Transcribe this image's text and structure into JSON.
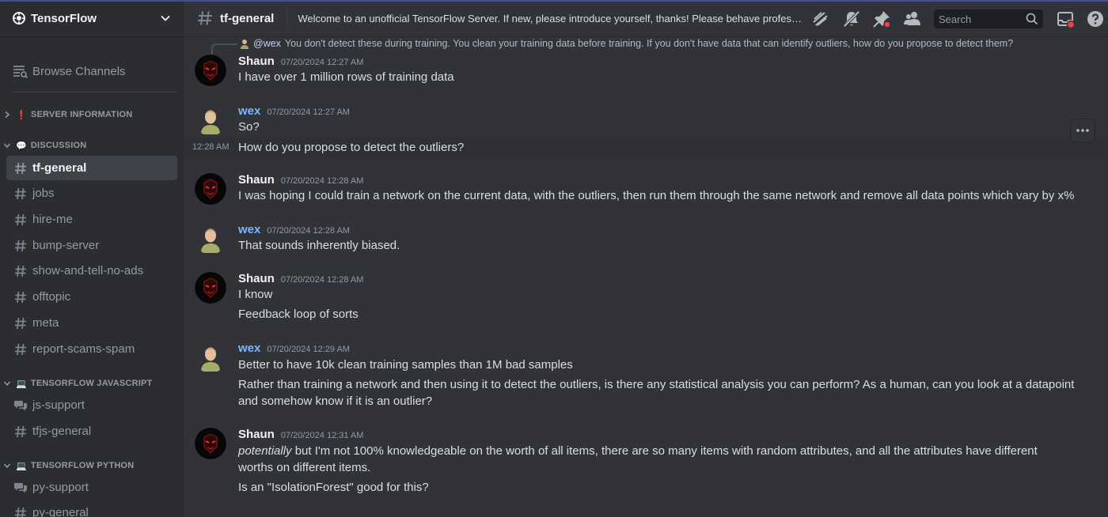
{
  "server": {
    "name": "TensorFlow"
  },
  "sidebar": {
    "browse_label": "Browse Channels",
    "categories": [
      {
        "label": "SERVER INFORMATION",
        "emoji": "❗"
      },
      {
        "label": "DISCUSSION",
        "emoji": "💬"
      },
      {
        "label": "TENSORFLOW JAVASCRIPT",
        "emoji": "💻"
      },
      {
        "label": "TENSORFLOW PYTHON",
        "emoji": "💻"
      }
    ],
    "channels": [
      {
        "label": "tf-general",
        "icon": "hash-icon",
        "active": true
      },
      {
        "label": "jobs",
        "icon": "hash-icon"
      },
      {
        "label": "hire-me",
        "icon": "hash-icon"
      },
      {
        "label": "bump-server",
        "icon": "hash-icon"
      },
      {
        "label": "show-and-tell-no-ads",
        "icon": "hash-icon"
      },
      {
        "label": "offtopic",
        "icon": "hash-icon"
      },
      {
        "label": "meta",
        "icon": "hash-icon"
      },
      {
        "label": "report-scams-spam",
        "icon": "hash-icon"
      },
      {
        "label": "js-support",
        "icon": "forum-icon"
      },
      {
        "label": "tfjs-general",
        "icon": "hash-icon"
      },
      {
        "label": "py-support",
        "icon": "forum-icon"
      },
      {
        "label": "py-general",
        "icon": "hash-icon"
      }
    ]
  },
  "header": {
    "channel_name": "tf-general",
    "topic": "Welcome to an unofficial TensorFlow Server. If new, please introduce yourself, thanks! Please behave professi...",
    "search_placeholder": "Search",
    "icons": [
      "threads-icon",
      "notification-muted-icon",
      "pinned-messages-icon",
      "member-list-icon",
      "inbox-icon",
      "help-icon"
    ]
  },
  "colors": {
    "accent": "#5865f2",
    "wex_name": "#7eb6ff",
    "muted_icon_red": "#f23f43"
  },
  "messages": {
    "reply": {
      "author": "@wex",
      "text": "You don't detect these during training. You clean your training data before training. If you don't have data that can identify outliers, how do you propose to detect them?"
    },
    "m1": {
      "author": "Shaun",
      "timestamp": "07/20/2024 12:27 AM",
      "lines": [
        "I have over 1 million rows of training data"
      ]
    },
    "m2": {
      "author": "wex",
      "timestamp": "07/20/2024 12:27 AM",
      "lines": [
        "So?"
      ]
    },
    "m2b": {
      "timestamp": "12:28 AM",
      "lines": [
        "How do you propose to detect the outliers?"
      ]
    },
    "m3": {
      "author": "Shaun",
      "timestamp": "07/20/2024 12:28 AM",
      "lines": [
        "I was hoping I could train a network on the current data, with the outliers, then run them through the same network and remove all data points which vary by x%"
      ]
    },
    "m4": {
      "author": "wex",
      "timestamp": "07/20/2024 12:28 AM",
      "lines": [
        "That sounds inherently biased."
      ]
    },
    "m5": {
      "author": "Shaun",
      "timestamp": "07/20/2024 12:28 AM",
      "lines": [
        "I know",
        "Feedback loop of sorts"
      ]
    },
    "m6": {
      "author": "wex",
      "timestamp": "07/20/2024 12:29 AM",
      "lines": [
        "Better to have 10k clean training samples than 1M bad samples",
        "Rather than training a network and then using it to detect the outliers, is there any statistical analysis you can perform? As a human, can you look at a datapoint",
        "and somehow know if it is an outlier?"
      ]
    },
    "m7": {
      "author": "Shaun",
      "timestamp": "07/20/2024 12:31 AM",
      "lines_italic": "potentially",
      "lines": [
        " but I'm not 100% knowledgeable on the worth of all items, there are so many items with random attributes, and all the attributes have different",
        "worths on different items.",
        "Is an \"IsolationForest\" good for this?"
      ]
    }
  }
}
